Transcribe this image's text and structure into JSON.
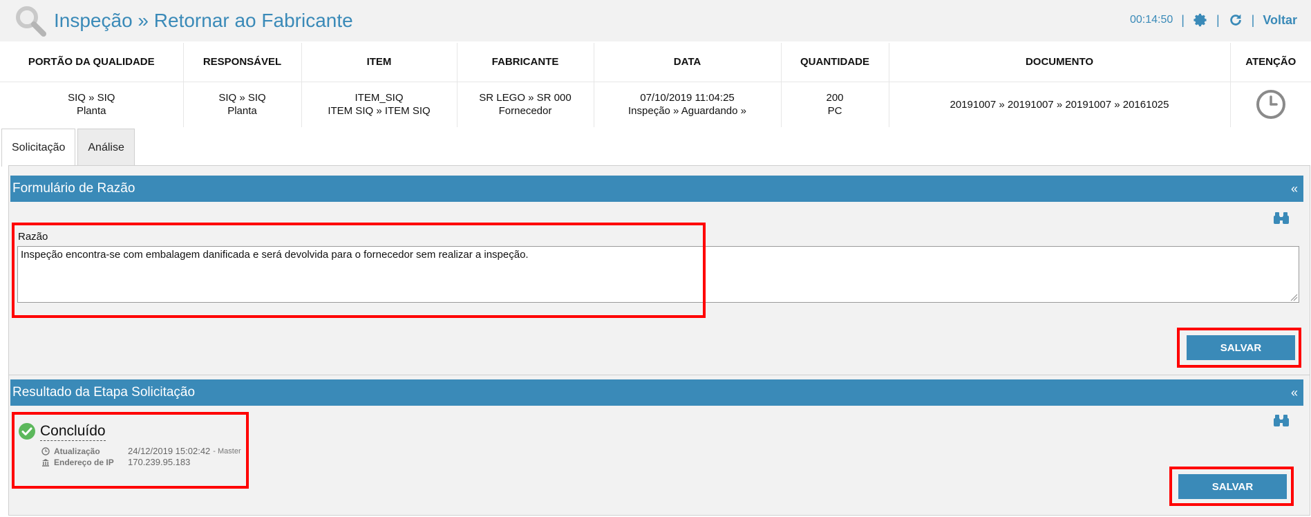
{
  "header": {
    "title": "Inspeção » Retornar ao Fabricante",
    "timer": "00:14:50",
    "separator": "|",
    "back_label": "Voltar",
    "icons": [
      "search-icon",
      "gear-icon",
      "refresh-icon"
    ]
  },
  "info_table": {
    "columns": [
      "PORTÃO DA QUALIDADE",
      "RESPONSÁVEL",
      "ITEM",
      "FABRICANTE",
      "DATA",
      "QUANTIDADE",
      "DOCUMENTO",
      "ATENÇÃO"
    ],
    "row": {
      "gate_line1": "SIQ » SIQ",
      "gate_line2": "Planta",
      "resp_line1": "SIQ » SIQ",
      "resp_line2": "Planta",
      "item_line1": "ITEM_SIQ",
      "item_line2": "ITEM SIQ » ITEM SIQ",
      "maker_line1": "SR LEGO » SR 000",
      "maker_line2": "Fornecedor",
      "date_line1": "07/10/2019 11:04:25",
      "date_line2": "Inspeção » Aguardando »",
      "qty_line1": "200",
      "qty_line2": "PC",
      "document": "20191007 » 20191007 » 20191007 » 20161025",
      "attention_icon": "clock-icon"
    }
  },
  "tabs": [
    {
      "label": "Solicitação",
      "active": true
    },
    {
      "label": "Análise",
      "active": false
    }
  ],
  "form_section": {
    "title": "Formulário de Razão",
    "collapse_glyph": "«",
    "field_label": "Razão",
    "reason_text": "Inspeção encontra-se com embalagem danificada e será devolvida para o fornecedor sem realizar a inspeção.",
    "save_label": "SALVAR"
  },
  "result_section": {
    "title": "Resultado da Etapa Solicitação",
    "collapse_glyph": "«",
    "status": "Concluído",
    "update_label": "Atualização",
    "update_value": "24/12/2019 15:02:42",
    "update_user": "- Master",
    "ip_label": "Endereço de IP",
    "ip_value": "170.239.95.183",
    "save_label": "SALVAR"
  },
  "colors": {
    "accent": "#3a8ab8",
    "highlight": "#ff0000",
    "success": "#5cb85c"
  }
}
